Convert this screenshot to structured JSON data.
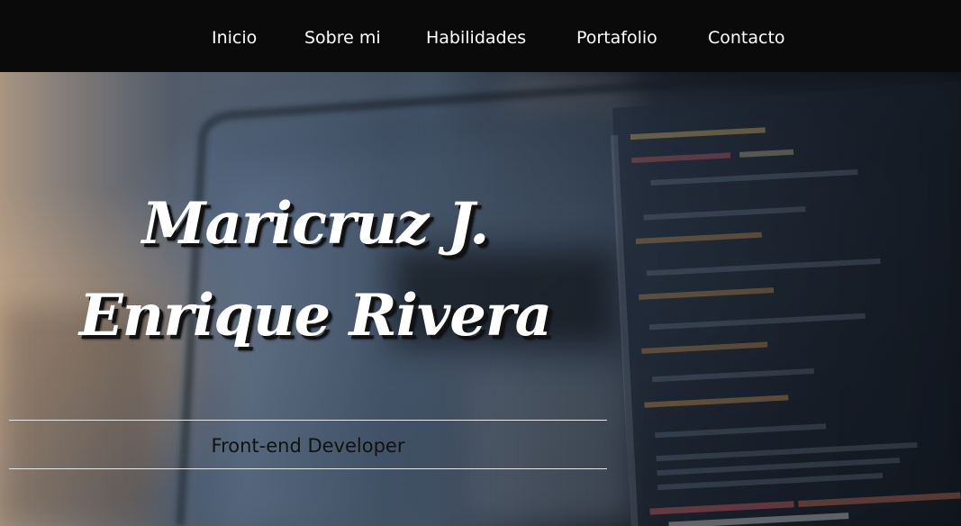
{
  "nav": {
    "items": [
      {
        "label": "Inicio"
      },
      {
        "label": "Sobre mi"
      },
      {
        "label": "Habilidades"
      },
      {
        "label": "Portafolio"
      },
      {
        "label": "Contacto"
      }
    ]
  },
  "hero": {
    "name_line1": "Maricruz J.",
    "name_line2": "Enrique Rivera",
    "subtitle": "Front-end Developer",
    "background_image": "laptop-code-photo"
  },
  "colors": {
    "nav_bg": "#0a0a0a",
    "text_light": "#ffffff",
    "text_dark": "#111111"
  }
}
